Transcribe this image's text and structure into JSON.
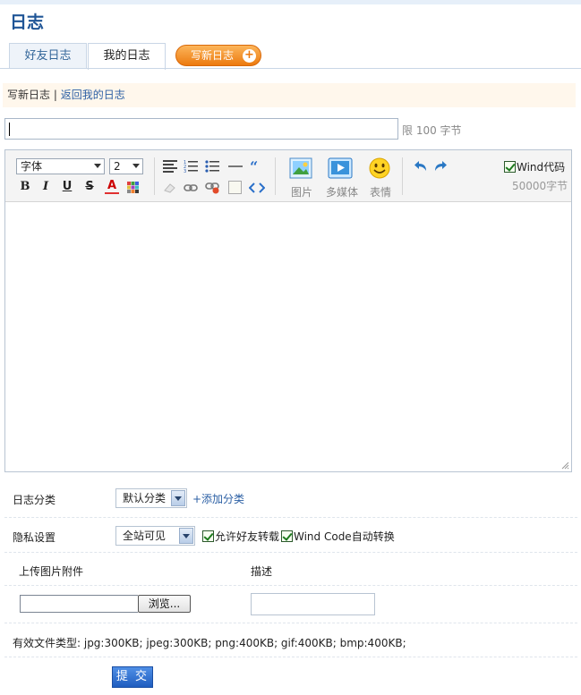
{
  "page": {
    "title": "日志"
  },
  "tabs": [
    {
      "label": "好友日志",
      "active": false
    },
    {
      "label": "我的日志",
      "active": true
    }
  ],
  "write_button": {
    "label": "写新日志",
    "icon": "plus-icon"
  },
  "breadcrumb": {
    "current": "写新日志",
    "separator": "|",
    "back_link": "返回我的日志"
  },
  "title_field": {
    "value": "",
    "limit_text": "限 100 字节"
  },
  "editor": {
    "font_select": "字体",
    "size_select": "2",
    "media_buttons": [
      {
        "label": "图片",
        "icon": "image-icon"
      },
      {
        "label": "多媒体",
        "icon": "media-icon"
      },
      {
        "label": "表情",
        "icon": "smiley-icon"
      }
    ],
    "wind_code": {
      "label": "Wind代码",
      "checked": true
    },
    "char_limit": "50000字节",
    "content": ""
  },
  "form": {
    "category": {
      "label": "日志分类",
      "selected": "默认分类",
      "add_link": "+添加分类"
    },
    "privacy": {
      "label": "隐私设置",
      "selected": "全站可见",
      "allow_share": {
        "label": "允许好友转载",
        "checked": true
      },
      "auto_convert": {
        "label": "Wind Code自动转换",
        "checked": true
      }
    },
    "upload": {
      "header_attachment": "上传图片附件",
      "header_desc": "描述",
      "browse_label": "浏览...",
      "file_types": "有效文件类型: jpg:300KB; jpeg:300KB; png:400KB; gif:400KB; bmp:400KB;"
    },
    "submit_label": "提 交"
  },
  "colors": {
    "accent": "#1f5596",
    "orange": "#ec7a10",
    "link": "#2b5fa4"
  }
}
